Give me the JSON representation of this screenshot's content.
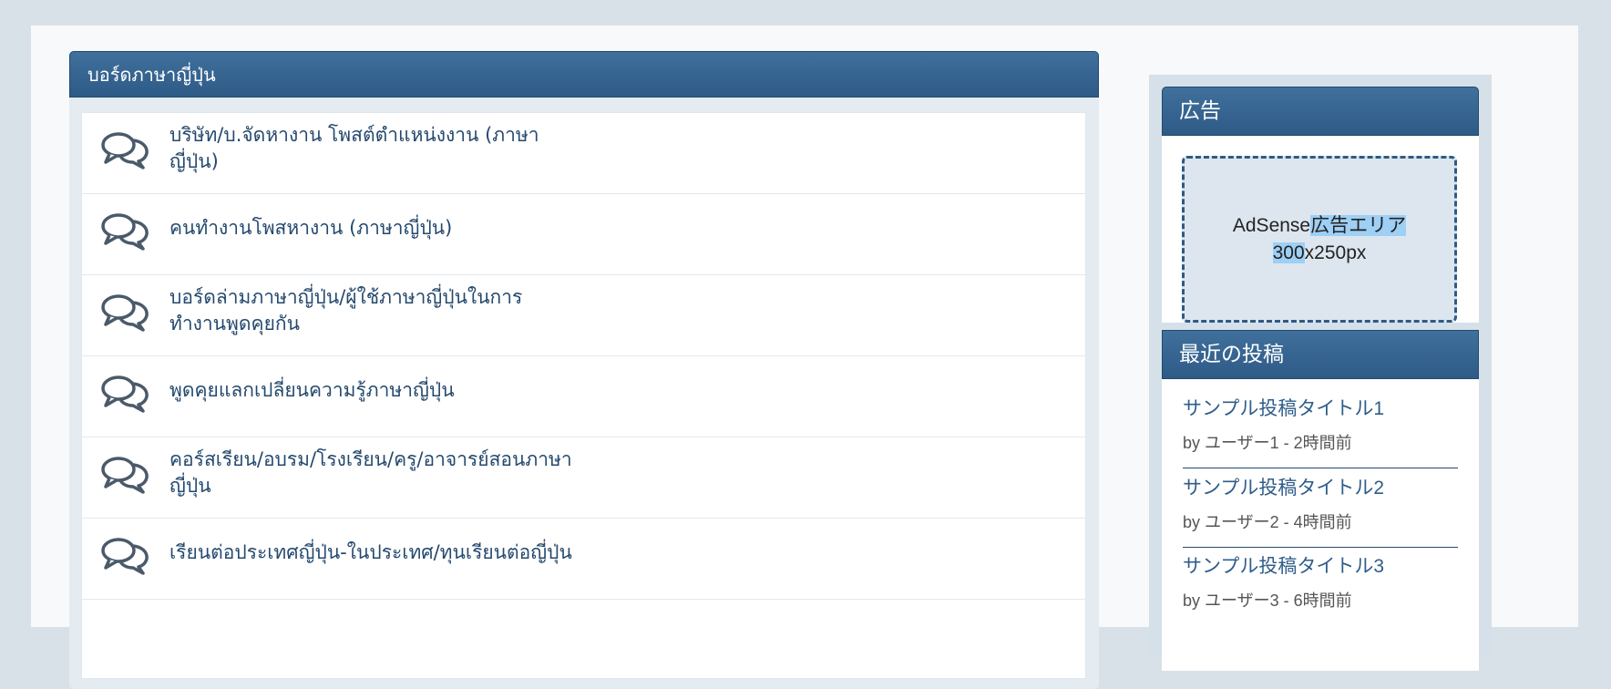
{
  "board": {
    "title": "บอร์ดภาษาญี่ปุ่น",
    "forums": [
      {
        "lines": [
          "บริษัท/บ.จัดหางาน โพสต์ตำแหน่งงาน (ภาษา",
          "ญี่ปุ่น)"
        ],
        "icon": "chat-bubbles-icon"
      },
      {
        "lines": [
          "คนทำงานโพสหางาน (ภาษาญี่ปุ่น)"
        ],
        "icon": "chat-bubbles-icon"
      },
      {
        "lines": [
          "บอร์ดล่ามภาษาญี่ปุ่น/ผู้ใช้ภาษาญี่ปุ่นในการ",
          "ทำงานพูดคุยกัน"
        ],
        "icon": "chat-bubbles-icon"
      },
      {
        "lines": [
          "พูดคุยแลกเปลี่ยนความรู้ภาษาญี่ปุ่น"
        ],
        "icon": "chat-bubbles-icon"
      },
      {
        "lines": [
          "คอร์สเรียน/อบรม/โรงเรียน/ครู/อาจารย์สอนภาษา",
          "ญี่ปุ่น"
        ],
        "icon": "chat-bubbles-icon"
      },
      {
        "lines": [
          "เรียนต่อประเทศญี่ปุ่น-ในประเทศ/ทุนเรียนต่อญี่ปุ่น"
        ],
        "icon": "chat-bubbles-icon"
      }
    ]
  },
  "sidebar": {
    "ad_title": "広告",
    "ad_text_1_a": "AdSense",
    "ad_text_1_b": "広告エリア ",
    "ad_text_2_a": "300",
    "ad_text_2_b": "x250px",
    "recent_title": "最近の投稿",
    "posts": [
      {
        "title": "サンプル投稿タイトル1",
        "meta": "by ユーザー1 - 2時間前"
      },
      {
        "title": "サンプル投稿タイトル2",
        "meta": "by ユーザー2 - 4時間前"
      },
      {
        "title": "サンプル投稿タイトル3",
        "meta": "by ユーザー3 - 6時間前"
      }
    ]
  },
  "colors": {
    "header": "#2e5a86",
    "link": "#24496e",
    "page_bg": "#d9e1e8",
    "highlight": "#9ecff5"
  }
}
